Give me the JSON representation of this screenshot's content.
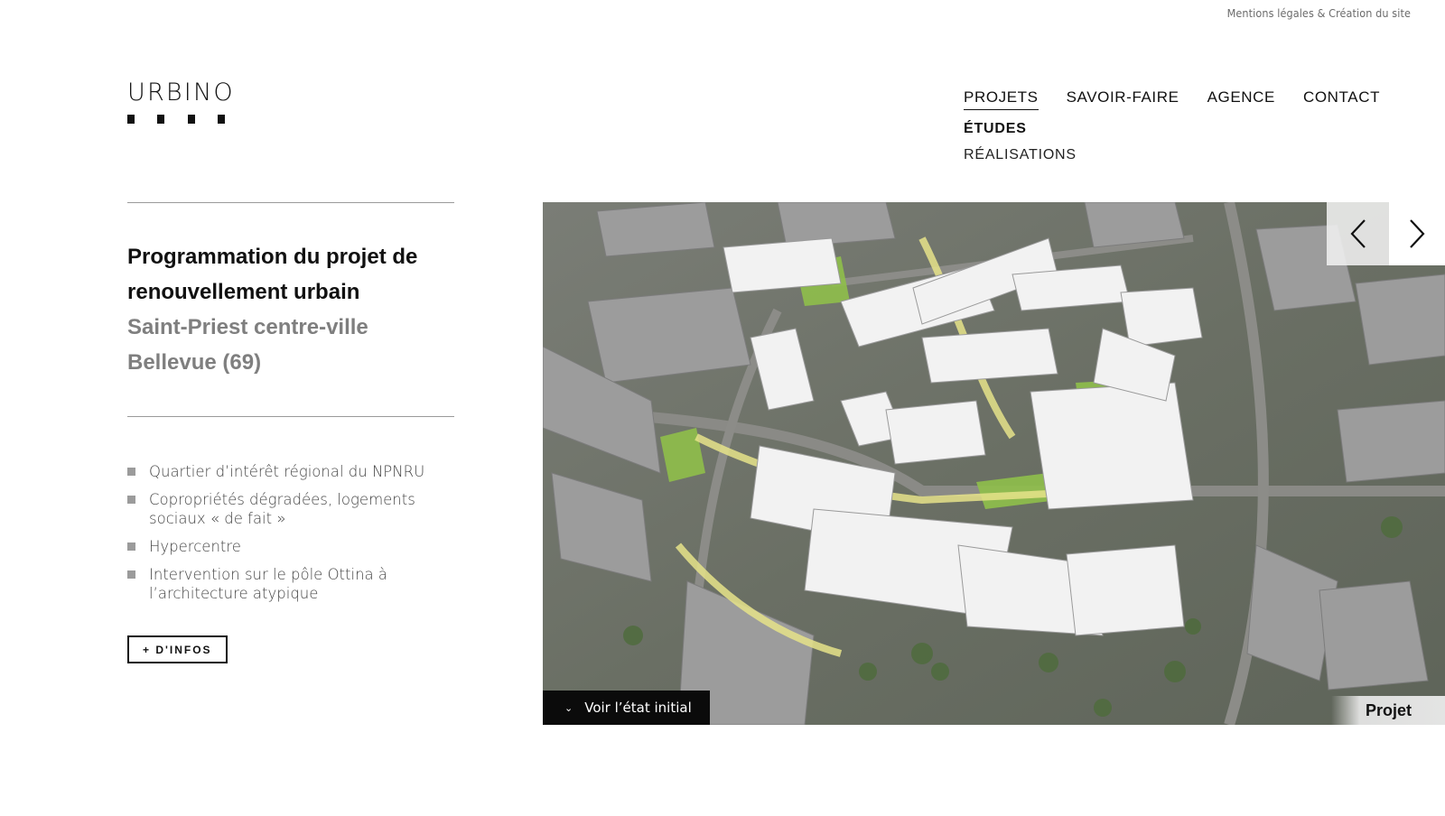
{
  "top_links": {
    "text": "Mentions légales & Création du site"
  },
  "logo": {
    "text": "URBINO"
  },
  "nav": {
    "items": [
      {
        "label": "PROJETS",
        "active": true
      },
      {
        "label": "SAVOIR-FAIRE",
        "active": false
      },
      {
        "label": "AGENCE",
        "active": false
      },
      {
        "label": "CONTACT",
        "active": false
      }
    ],
    "subitems": [
      {
        "label": "ÉTUDES",
        "current": true
      },
      {
        "label": "RÉALISATIONS",
        "current": false
      }
    ]
  },
  "project": {
    "title_line1": "Programmation du projet de",
    "title_line2": "renouvellement urbain",
    "subtitle_line1": "Saint-Priest centre-ville",
    "subtitle_line2": "Bellevue (69)",
    "features": [
      {
        "text": "Quartier d’intérêt régional du NPNRU"
      },
      {
        "text": "Copropriétés dégradées, logements sociaux « de fait »"
      },
      {
        "text": "Hypercentre"
      },
      {
        "text": "Intervention sur le pôle Ottina à l’architecture atypique"
      }
    ],
    "info_button": "+ D'INFOS"
  },
  "hero": {
    "toggle_label": "Voir l’état initial",
    "image_label": "Projet",
    "colors": {
      "aerial_base": "#6b6e68",
      "grass": "#8fbf4a",
      "highlight": "#e6e38a",
      "building": "#f2f2f2",
      "existing": "#9b9b9b"
    }
  },
  "icons": {
    "prev": "chevron-left-icon",
    "next": "chevron-right-icon",
    "toggle": "chevron-down-icon"
  }
}
